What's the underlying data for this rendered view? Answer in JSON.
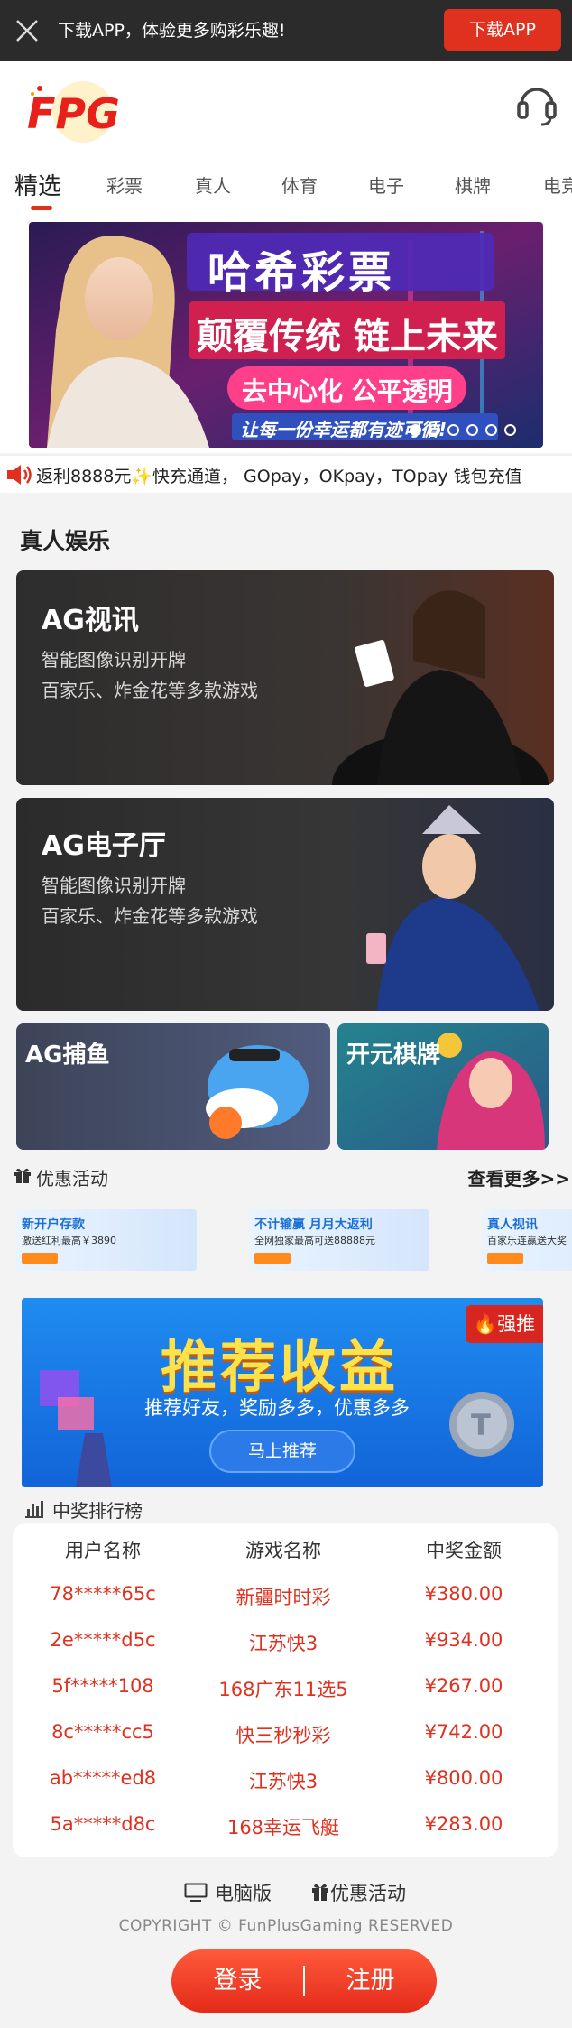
{
  "download_bar": {
    "text": "下载APP，体验更多购彩乐趣!",
    "button": "下载APP"
  },
  "header": {
    "logo_text": "FPG",
    "support_icon": "headset-icon"
  },
  "tabs": [
    "精选",
    "彩票",
    "真人",
    "体育",
    "电子",
    "棋牌",
    "电竞"
  ],
  "banner": {
    "headline": "哈希彩票",
    "line2": "颠覆传统 链上未来",
    "line3": "去中心化 公平透明",
    "line4": "让每一份幸运都有迹可循!"
  },
  "notice": {
    "text": "返利8888元✨快充通道， GOpay，OKpay，TOpay 钱包充值"
  },
  "section_title": "真人娱乐",
  "games": [
    {
      "title": "AG视讯",
      "desc1": "智能图像识别开牌",
      "desc2": "百家乐、炸金花等多款游戏"
    },
    {
      "title": "AG电子厅",
      "desc1": "智能图像识别开牌",
      "desc2": "百家乐、炸金花等多款游戏"
    },
    {
      "title": "AG捕鱼"
    },
    {
      "title": "开元棋牌"
    }
  ],
  "promotions": {
    "label": "优惠活动",
    "more": "查看更多>>",
    "items": [
      {
        "title": "新开户存款",
        "sub": "激送红利最高￥3890"
      },
      {
        "title": "不计输赢 月月大返利",
        "sub": "全网独家最高可送88888元"
      },
      {
        "title": "真人视讯",
        "sub": "百家乐连赢送大奖"
      }
    ]
  },
  "recommend": {
    "title": "推荐收益",
    "subtitle": "推荐好友，奖励多多，优惠多多",
    "button": "马上推荐",
    "tag": "强推"
  },
  "ranking": {
    "label": "中奖排行榜",
    "headers": [
      "用户名称",
      "游戏名称",
      "中奖金额"
    ],
    "rows": [
      [
        "78*****65c",
        "新疆时时彩",
        "¥380.00"
      ],
      [
        "2e*****d5c",
        "江苏快3",
        "¥934.00"
      ],
      [
        "5f*****108",
        "168广东11选5",
        "¥267.00"
      ],
      [
        "8c*****cc5",
        "快三秒秒彩",
        "¥742.00"
      ],
      [
        "ab*****ed8",
        "江苏快3",
        "¥800.00"
      ],
      [
        "5a*****d8c",
        "168幸运飞艇",
        "¥283.00"
      ]
    ]
  },
  "footer": {
    "pc": "电脑版",
    "promo": "优惠活动",
    "copyright": "COPYRIGHT © FunPlusGaming RESERVED",
    "login": "登录",
    "register": "注册"
  },
  "colors": {
    "accent": "#e0301e",
    "dark_bar": "#2b2b2b",
    "rank_text": "#e0301e"
  }
}
